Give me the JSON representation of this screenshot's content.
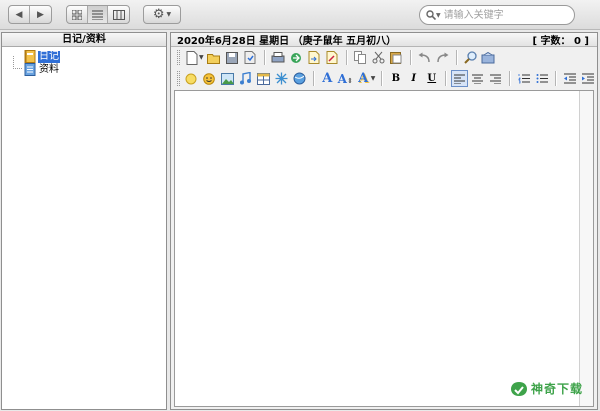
{
  "toolbar": {
    "back_glyph": "◀",
    "forward_glyph": "▶",
    "view_icons": [
      "grid-view-icon",
      "list-view-icon",
      "column-view-icon"
    ],
    "settings_icon": "gear-icon",
    "search_placeholder": "请输入关键字"
  },
  "sidebar": {
    "header": "日记/资料",
    "items": [
      {
        "label": "日记",
        "icon": "diary-book-icon",
        "selected": true
      },
      {
        "label": "资料",
        "icon": "document-icon",
        "selected": false
      }
    ]
  },
  "editor": {
    "date_line": "2020年6月28日  星期日 （庚子鼠年  五月初八）",
    "word_count_label": "[ 字数： 0 ]",
    "format_bold": "B",
    "format_italic": "I",
    "format_underline": "U"
  },
  "watermark": {
    "text": "神奇下载"
  },
  "colors": {
    "selection": "#2f6fd6",
    "watermark": "#3ea34a"
  }
}
